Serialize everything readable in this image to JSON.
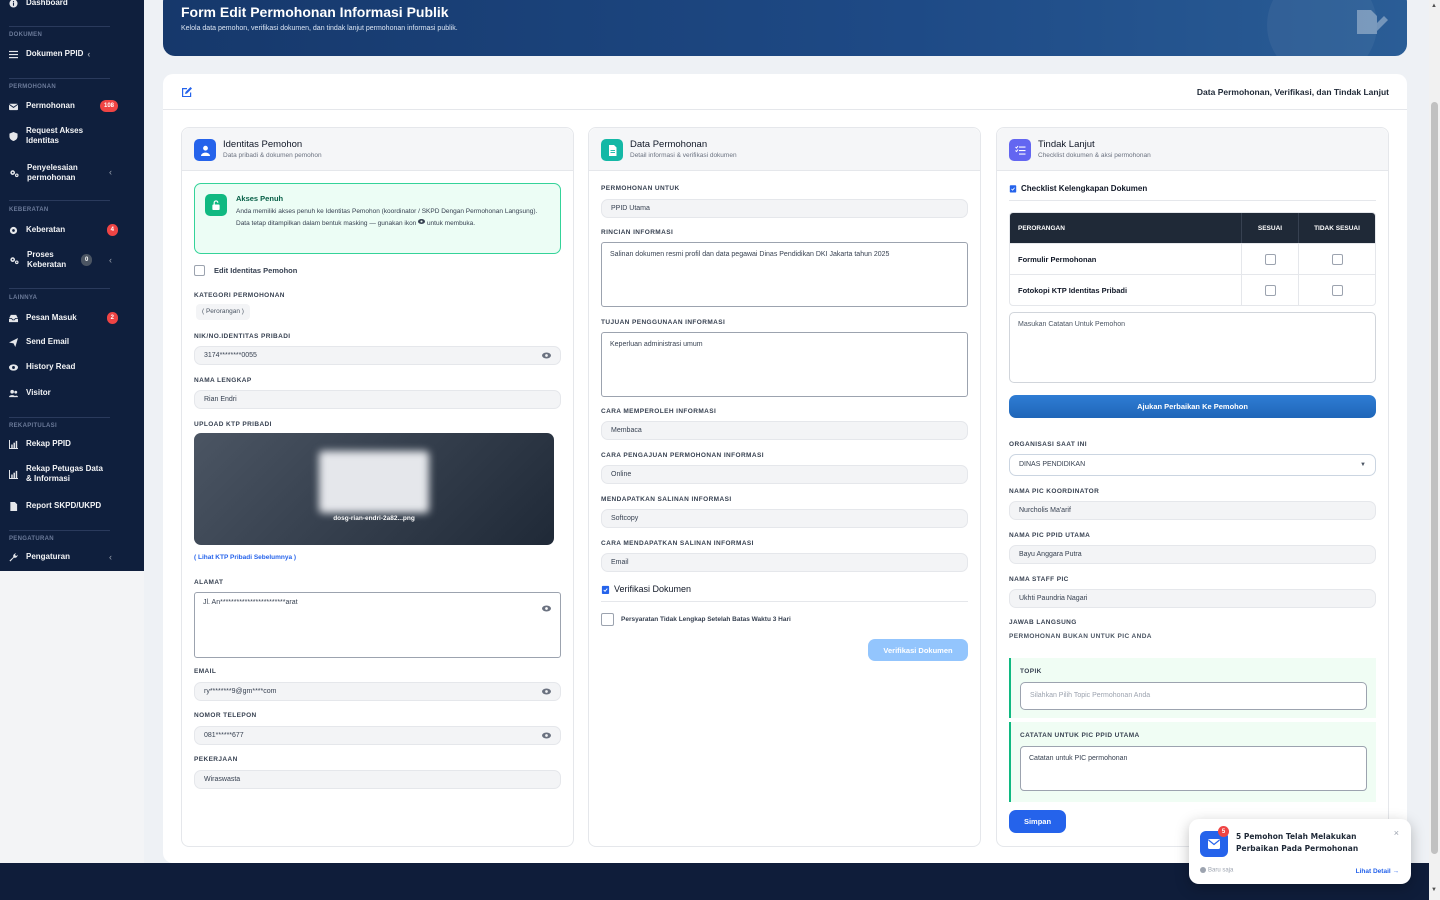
{
  "sidebar": {
    "dashboard": "Dashboard",
    "sections": {
      "dokumen": "DOKUMEN",
      "permohonan": "PERMOHONAN",
      "keberatan": "KEBERATAN",
      "lainnya": "LAINNYA",
      "rekapitulasi": "REKAPITULASI",
      "pengaturan": "PENGATURAN"
    },
    "items": {
      "dokumen_ppid": "Dokumen PPID",
      "permohonan": "Permohonan",
      "permohonan_badge": "108",
      "request_akses": "Request Akses Identitas",
      "penyelesaian": "Penyelesaian permohonan",
      "keberatan": "Keberatan",
      "keberatan_badge": "4",
      "proses_keberatan": "Proses Keberatan",
      "proses_badge": "0",
      "pesan_masuk": "Pesan Masuk",
      "pesan_badge": "2",
      "send_email": "Send Email",
      "history_read": "History Read",
      "visitor": "Visitor",
      "rekap_ppid": "Rekap PPID",
      "rekap_petugas": "Rekap Petugas Data & Informasi",
      "report_skpd": "Report SKPD/UKPD",
      "pengaturan": "Pengaturan"
    }
  },
  "hero": {
    "title": "Form Edit Permohonan Informasi Publik",
    "subtitle": "Kelola data pemohon, verifikasi dokumen, dan tindak lanjut permohonan informasi publik."
  },
  "card": {
    "title": "Data Permohonan, Verifikasi, dan Tindak Lanjut"
  },
  "identitas": {
    "title": "Identitas Pemohon",
    "subtitle": "Data pribadi & dokumen pemohon",
    "akses_title": "Akses Penuh",
    "akses_text_1": "Anda memiliki akses penuh ke Identitas Pemohon (koordinator / SKPD Dengan Permohonan",
    "akses_text_2": "Langsung). Data tetap ditampilkan dalam bentuk masking — gunakan ikon",
    "akses_text_3": "untuk",
    "akses_text_4": "membuka.",
    "edit_label": "Edit Identitas Pemohon",
    "kategori_label": "KATEGORI PERMOHONAN",
    "kategori_value": "( Perorangan )",
    "nik_label": "NIK/NO.IDENTITAS PRIBADI",
    "nik_value": "3174********0055",
    "nama_label": "NAMA LENGKAP",
    "nama_value": "Rian Endri",
    "upload_label": "UPLOAD KTP PRIBADI",
    "file_name": "dosg-rian-endri-2a82...png",
    "lihat_link": "( Lihat KTP Pribadi Sebelumnya )",
    "alamat_label": "ALAMAT",
    "alamat_value": "Jl. An************************arat",
    "email_label": "EMAIL",
    "email_value": "ry********9@gm****com",
    "telepon_label": "NOMOR TELEPON",
    "telepon_value": "081******677",
    "pekerjaan_label": "PEKERJAAN",
    "pekerjaan_value": "Wiraswasta"
  },
  "permohonan": {
    "title": "Data Permohonan",
    "subtitle": "Detail informasi & verifikasi dokumen",
    "untuk_label": "PERMOHONAN UNTUK",
    "untuk_value": "PPID Utama",
    "rincian_label": "RINCIAN INFORMASI",
    "rincian_value": "Salinan dokumen resmi profil dan data pegawai Dinas Pendidikan DKI Jakarta tahun 2025",
    "tujuan_label": "TUJUAN PENGGUNAAN INFORMASI",
    "tujuan_value": "Keperluan administrasi umum",
    "cara_label": "CARA MEMPEROLEH INFORMASI",
    "cara_value": "Membaca",
    "pengajuan_label": "CARA PENGAJUAN PERMOHONAN INFORMASI",
    "pengajuan_value": "Online",
    "salinan_label": "MENDAPATKAN SALINAN INFORMASI",
    "salinan_value": "Softcopy",
    "cara_salinan_label": "CARA MENDAPATKAN SALINAN INFORMASI",
    "cara_salinan_value": "Email",
    "verifikasi_title": "Verifikasi Dokumen",
    "persyaratan_label": "Persyaratan Tidak Lengkap Setelah Batas Waktu 3 Hari",
    "verifikasi_button": "Verifikasi Dokumen"
  },
  "tindak": {
    "title": "Tindak Lanjut",
    "subtitle": "Checklist dokumen & aksi permohonan",
    "checklist_title": "Checklist Kelengkapan Dokumen",
    "table_headers": [
      "PERORANGAN",
      "SESUAI",
      "TIDAK SESUAI"
    ],
    "rows": [
      "Formulir Permohonan",
      "Fotokopi KTP Identitas Pribadi"
    ],
    "catatan_placeholder": "Masukan Catatan Untuk Pemohon",
    "ajukan_button": "Ajukan Perbaikan Ke Pemohon",
    "organisasi_label": "ORGANISASI SAAT INI",
    "organisasi_value": "DINAS PENDIDIKAN",
    "koordinator_label": "NAMA PIC KOORDINATOR",
    "koordinator_value": "Nurcholis Ma'arif",
    "ppid_utama_label": "NAMA PIC PPID UTAMA",
    "ppid_utama_value": "Bayu Anggara Putra",
    "staff_label": "NAMA STAFF PIC",
    "staff_value": "Ukhti Paundria Nagari",
    "jawab_label": "JAWAB LANGSUNG",
    "bukan_label": "PERMOHONAN BUKAN UNTUK PIC ANDA",
    "topik_label": "TOPIK",
    "topik_placeholder": "Silahkan Pilih Topic Permohonan Anda",
    "catatan_pic_label": "CATATAN UNTUK PIC PPID UTAMA",
    "catatan_pic_placeholder": "Catatan untuk PIC permohonan",
    "simpan_button": "Simpan"
  },
  "toast": {
    "badge": "5",
    "message": "5 Pemohon Telah Melakukan Perbaikan Pada Permohonan",
    "time": "Baru saja",
    "link": "Lihat Detail →",
    "close": "×"
  },
  "colors": {
    "sidebar": "#0f1f3d",
    "accent_blue": "#2563eb",
    "accent_teal": "#14b8a6",
    "accent_purple": "#6366f1",
    "success": "#10b981",
    "danger": "#ef4444"
  }
}
